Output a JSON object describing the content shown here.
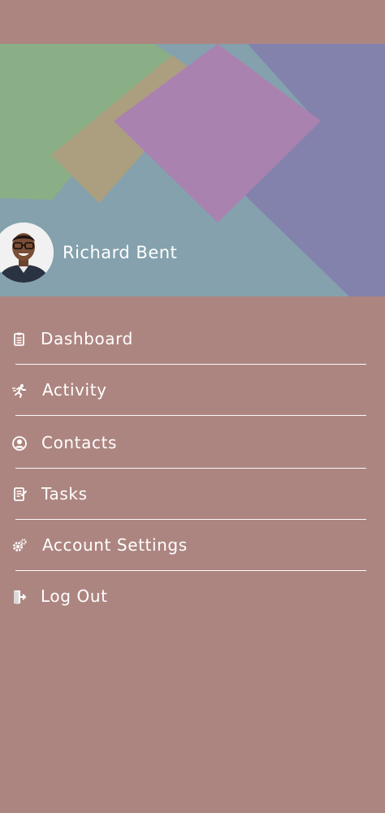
{
  "user": {
    "name": "Richard Bent"
  },
  "menu": [
    {
      "label": "Dashboard",
      "icon": "clipboard-icon"
    },
    {
      "label": "Activity",
      "icon": "running-person-icon"
    },
    {
      "label": "Contacts",
      "icon": "user-circle-icon"
    },
    {
      "label": "Tasks",
      "icon": "task-list-icon"
    },
    {
      "label": "Account Settings",
      "icon": "gears-icon"
    },
    {
      "label": "Log Out",
      "icon": "logout-door-icon"
    }
  ],
  "colors": {
    "background": "#ad8580",
    "header_base": "#84a1ad",
    "green": "#8aae86",
    "tan": "#ab9f80",
    "pink": "#a982b0",
    "purple": "#8382ad",
    "text": "#ffffff"
  }
}
